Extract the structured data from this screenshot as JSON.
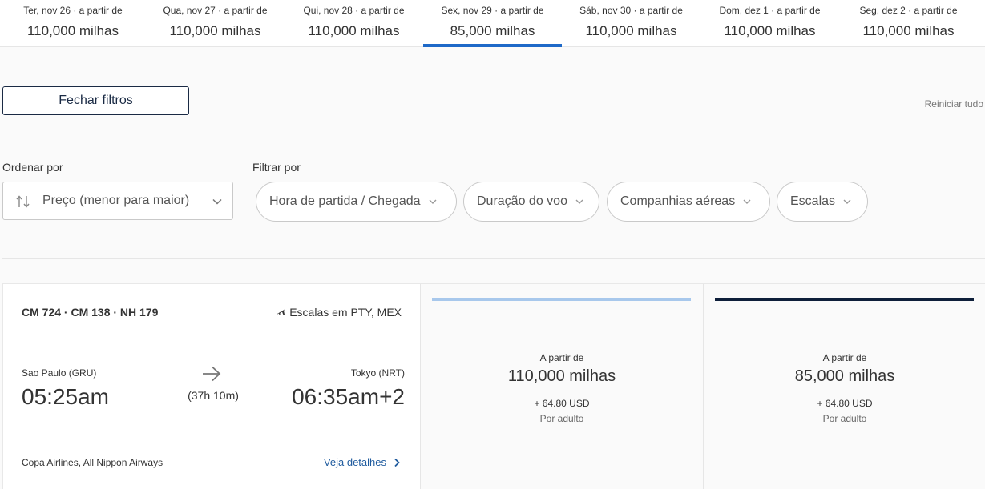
{
  "date_tabs": [
    {
      "label": "Ter, nov 26 · a partir de",
      "price": "110,000 milhas",
      "active": false
    },
    {
      "label": "Qua, nov 27 · a partir de",
      "price": "110,000 milhas",
      "active": false
    },
    {
      "label": "Qui, nov 28 · a partir de",
      "price": "110,000 milhas",
      "active": false
    },
    {
      "label": "Sex, nov 29 · a partir de",
      "price": "85,000 milhas",
      "active": true
    },
    {
      "label": "Sáb, nov 30 · a partir de",
      "price": "110,000 milhas",
      "active": false
    },
    {
      "label": "Dom, dez 1 · a partir de",
      "price": "110,000 milhas",
      "active": false
    },
    {
      "label": "Seg, dez 2 · a partir de",
      "price": "110,000 milhas",
      "active": false
    }
  ],
  "filters": {
    "close_label": "Fechar filtros",
    "reset_label": "Reiniciar tudo",
    "sort_label": "Ordenar por",
    "sort_value": "Preço (menor para maior)",
    "filter_label": "Filtrar por",
    "pills": [
      {
        "label": "Hora de partida / Chegada"
      },
      {
        "label": "Duração do voo"
      },
      {
        "label": "Companhias aéreas"
      },
      {
        "label": "Escalas"
      }
    ]
  },
  "flight": {
    "numbers": "CM 724 · CM 138 · NH 179",
    "stops": "Escalas em PTY, MEX",
    "origin_city": "Sao Paulo (GRU)",
    "origin_time": "05:25am",
    "duration": "(37h 10m)",
    "dest_city": "Tokyo (NRT)",
    "dest_time": "06:35am+2",
    "airlines": "Copa Airlines, All Nippon Airways",
    "details_label": "Veja detalhes"
  },
  "fares": [
    {
      "from": "A partir de",
      "miles": "110,000 milhas",
      "tax": "+ 64.80 USD",
      "per": "Por adulto",
      "bar_color": "#a8c8ec"
    },
    {
      "from": "A partir de",
      "miles": "85,000 milhas",
      "tax": "+ 64.80 USD",
      "per": "Por adulto",
      "bar_color": "#0e1f3a"
    }
  ],
  "colors": {
    "active_tab": "#1e69c8",
    "link": "#1f5b9e"
  }
}
